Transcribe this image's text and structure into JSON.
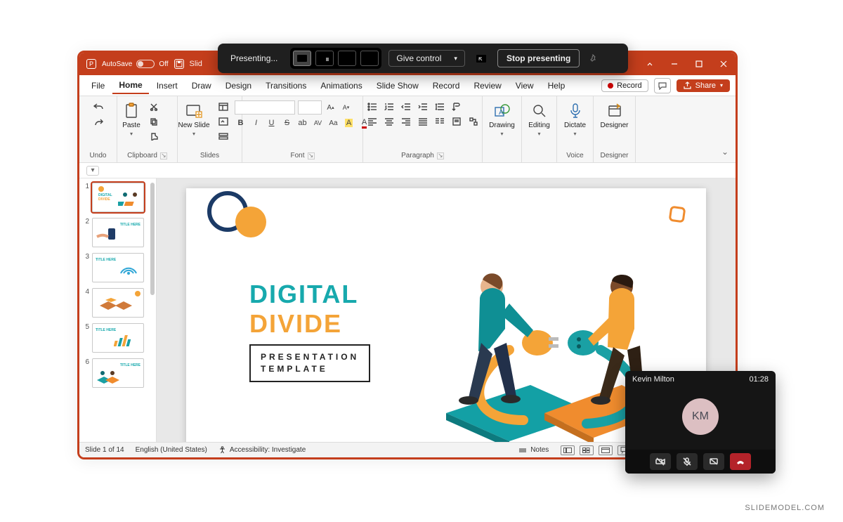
{
  "titlebar": {
    "autosave_label": "AutoSave",
    "autosave_state": "Off",
    "doc_prefix": "Slid"
  },
  "tabs": {
    "file": "File",
    "home": "Home",
    "insert": "Insert",
    "draw": "Draw",
    "design": "Design",
    "transitions": "Transitions",
    "animations": "Animations",
    "slideshow": "Slide Show",
    "record": "Record",
    "review": "Review",
    "view": "View",
    "help": "Help",
    "record_btn": "Record",
    "share": "Share"
  },
  "ribbon": {
    "undo": "Undo",
    "clipboard": "Clipboard",
    "paste": "Paste",
    "slides": "Slides",
    "new_slide": "New Slide",
    "font": "Font",
    "paragraph": "Paragraph",
    "drawing": "Drawing",
    "editing": "Editing",
    "dictate": "Dictate",
    "voice": "Voice",
    "designer": "Designer",
    "designer_group": "Designer",
    "bold": "B",
    "italic": "I",
    "underline": "U",
    "strike": "S",
    "sub_av": "AV",
    "caseAa": "Aa"
  },
  "thumbs": [
    "1",
    "2",
    "3",
    "4",
    "5",
    "6"
  ],
  "slide": {
    "title1": "DIGITAL",
    "title2": "DIVIDE",
    "sub1": "PRESENTATION",
    "sub2": "TEMPLATE"
  },
  "status": {
    "slide_counter": "Slide 1 of 14",
    "language": "English (United States)",
    "accessibility": "Accessibility: Investigate",
    "notes": "Notes"
  },
  "present": {
    "label": "Presenting...",
    "give_control": "Give control",
    "stop": "Stop presenting"
  },
  "call": {
    "name": "Kevin Milton",
    "time": "01:28",
    "initials": "KM"
  },
  "watermark": "SLIDEMODEL.COM",
  "thumb_labels": {
    "digital": "DIGITAL",
    "divide": "DIVIDE",
    "title_here": "TITLE HERE"
  }
}
